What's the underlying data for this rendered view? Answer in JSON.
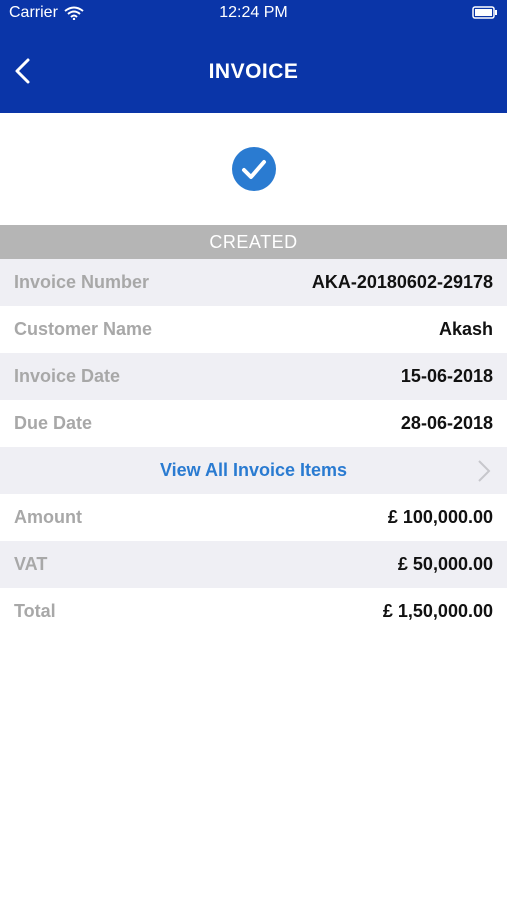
{
  "status_bar": {
    "carrier": "Carrier",
    "time": "12:24 PM"
  },
  "header": {
    "title": "INVOICE"
  },
  "invoice": {
    "status": "CREATED",
    "fields": [
      {
        "label": "Invoice Number",
        "value": "AKA-20180602-29178"
      },
      {
        "label": "Customer Name",
        "value": "Akash"
      },
      {
        "label": "Invoice Date",
        "value": "15-06-2018"
      },
      {
        "label": "Due Date",
        "value": "28-06-2018"
      }
    ],
    "view_items_label": "View All Invoice Items",
    "totals": [
      {
        "label": "Amount",
        "value": "£ 100,000.00"
      },
      {
        "label": "VAT",
        "value": "£ 50,000.00"
      },
      {
        "label": "Total",
        "value": "£ 1,50,000.00"
      }
    ]
  },
  "colors": {
    "header_bg": "#0a35a8",
    "accent": "#2a7bd1",
    "status_banner": "#b5b5b5"
  },
  "icons": {
    "back": "chevron-left-icon",
    "check": "check-circle-icon",
    "wifi": "wifi-icon",
    "battery": "battery-icon",
    "chevron": "chevron-right-icon"
  }
}
